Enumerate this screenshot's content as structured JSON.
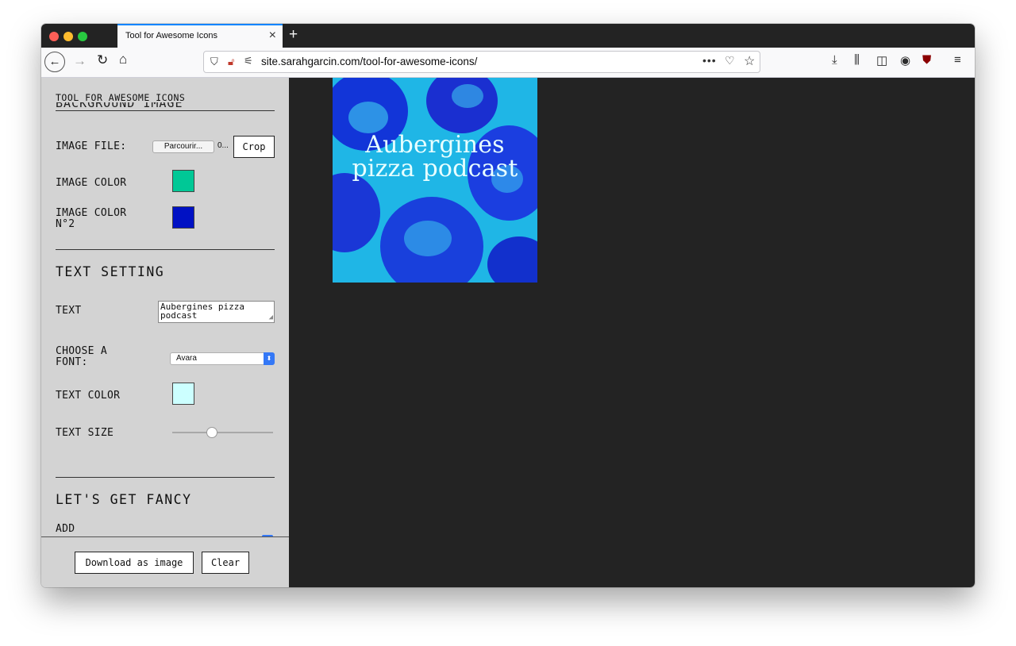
{
  "browser": {
    "tab_title": "Tool for Awesome Icons",
    "tab_close": "×",
    "new_tab": "+",
    "url": "site.sarahgarcin.com/tool-for-awesome-icons/",
    "url_more": "•••"
  },
  "sidebar": {
    "header": "TOOL FOR AWESOME ICONS",
    "background_heading_cut": "BACKGROUND IMAGE",
    "image_file_label": "IMAGE FILE:",
    "file_button": "Parcourir...",
    "file_name": "0...",
    "crop_button": "Crop",
    "image_color_label": "IMAGE COLOR",
    "image_color_value": "#00c896",
    "image_color2_label": "IMAGE COLOR N°2",
    "image_color2_value": "#0011c4",
    "text_setting_title": "TEXT SETTING",
    "text_label": "TEXT",
    "text_value": "Aubergines pizza podcast",
    "font_label": "CHOOSE A FONT:",
    "font_value": "Avara",
    "text_color_label": "TEXT COLOR",
    "text_color_value": "#ccffff",
    "text_size_label": "TEXT SIZE",
    "fancy_title": "LET'S GET FANCY",
    "add_label": "ADD"
  },
  "footer": {
    "download_button": "Download as image",
    "clear_button": "Clear"
  },
  "preview": {
    "text": "Aubergines pizza podcast"
  }
}
